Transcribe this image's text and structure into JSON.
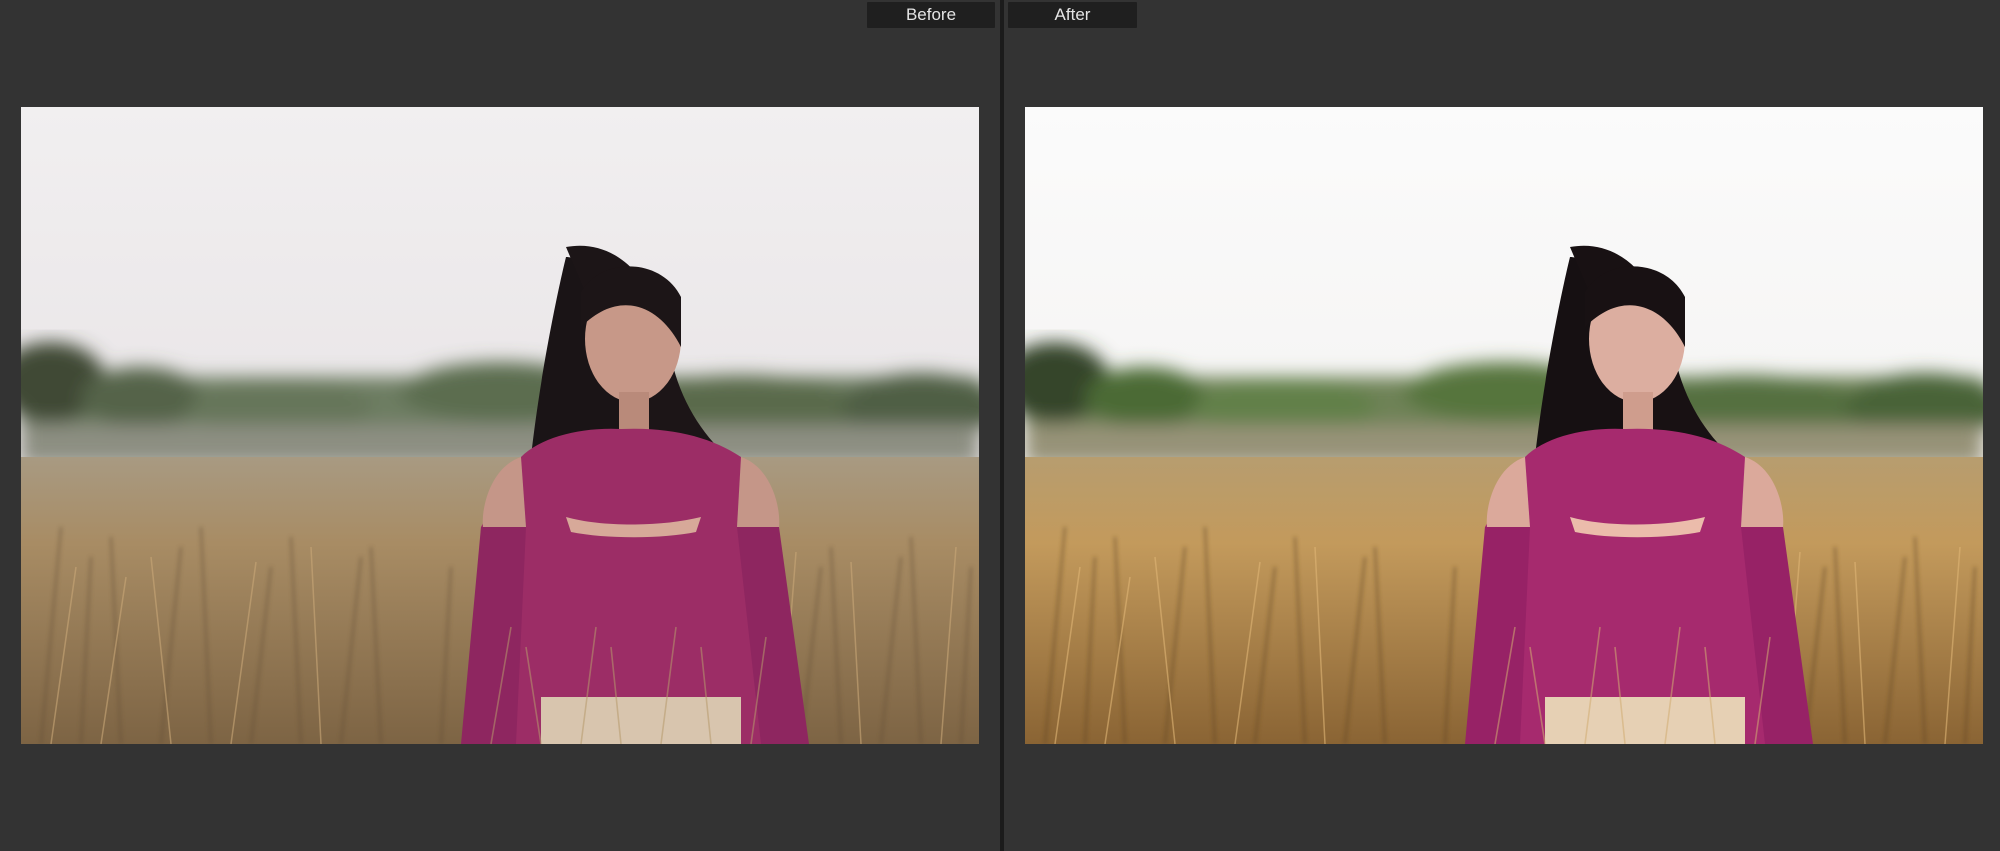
{
  "compare_view": {
    "before_label": "Before",
    "after_label": "After"
  },
  "colors": {
    "background": "#333333",
    "label_background": "#1f1f1f",
    "label_text": "#e4e4e4",
    "divider": "#1b1b1b"
  },
  "photos": {
    "before": {
      "icon": "portrait-photo-before",
      "tone": "muted"
    },
    "after": {
      "icon": "portrait-photo-after",
      "tone": "warm-bright"
    }
  }
}
